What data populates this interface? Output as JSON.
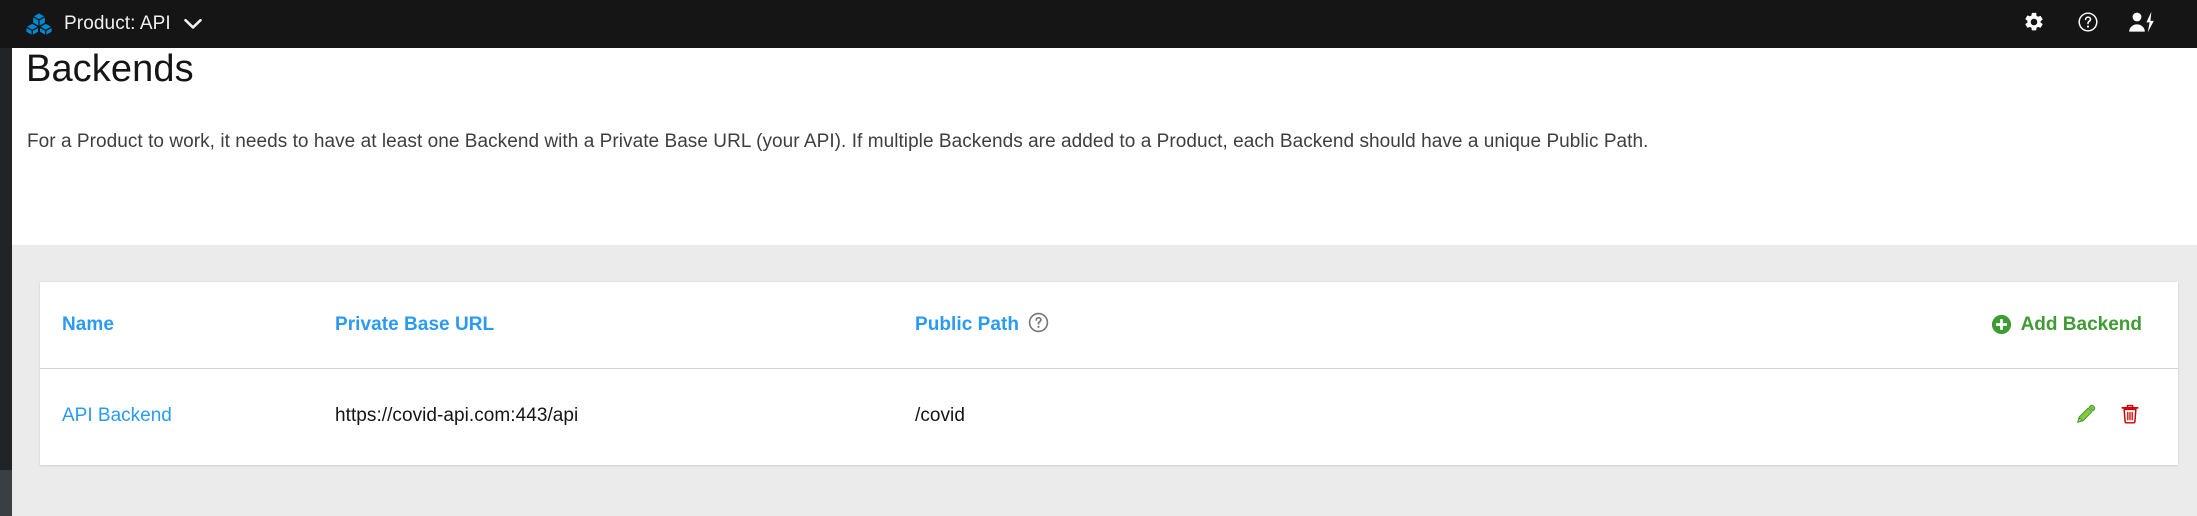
{
  "masthead": {
    "brand_icon": "cubes-icon",
    "product_label": "Product: API",
    "caret_icon": "chevron-down-icon",
    "actions": [
      {
        "icon": "gear-icon",
        "label": "Settings"
      },
      {
        "icon": "help-circle-icon",
        "label": "Help"
      },
      {
        "icon": "user-bolt-icon",
        "label": "Account"
      }
    ],
    "bg_color": "#151515",
    "brand_color": "#0088ce"
  },
  "page": {
    "title": "Backends",
    "description": "For a Product to work, it needs to have at least one Backend with a Private Base URL (your API). If multiple Backends are added to a Product, each Backend should have a unique Public Path.",
    "background": "#ebebeb"
  },
  "table": {
    "columns": [
      {
        "key": "name",
        "label": "Name",
        "link": true
      },
      {
        "key": "private_base_url",
        "label": "Private Base URL",
        "link": true
      },
      {
        "key": "public_path",
        "label": "Public Path",
        "link": true,
        "help_icon": "help-circle-icon"
      },
      {
        "key": "actions",
        "label": "",
        "link": false
      }
    ],
    "add_button": {
      "label": "Add Backend",
      "icon": "plus-circle-icon",
      "color": "#3f9c35"
    },
    "rows": [
      {
        "name": "API Backend",
        "private_base_url": "https://covid-api.com:443/api",
        "public_path": "/covid",
        "actions": [
          {
            "icon": "pencil-icon",
            "label": "Edit",
            "color": "#3f9c35"
          },
          {
            "icon": "trash-icon",
            "label": "Delete",
            "color": "#cc0000"
          }
        ]
      }
    ]
  },
  "colors": {
    "link_blue": "#2b9af3",
    "green": "#3f9c35",
    "red": "#cc0000",
    "rail_top": "#202427",
    "rail_bottom": "#3a3f43"
  }
}
